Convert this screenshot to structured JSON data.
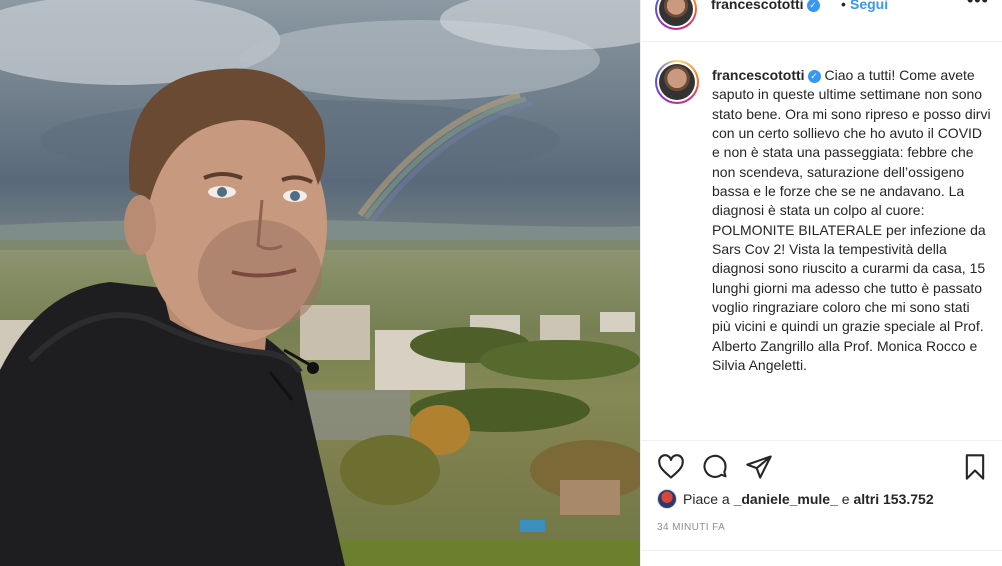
{
  "post": {
    "username": "francescototti",
    "verified": true,
    "follow_label": "Segui",
    "dot": "•",
    "more_label": "•••"
  },
  "caption": {
    "username": "francescototti",
    "text": "Ciao a tutti! Come avete saputo in queste ultime settimane non sono stato bene. Ora mi sono ripreso e posso dirvi con un certo sollievo che ho avuto il COVID e non è stata una passeggiata: febbre che non scendeva, saturazione dell’ossigeno bassa e le forze che se ne andavano. La diagnosi è stata un colpo al cuore: POLMONITE BILATERALE per infezione da Sars Cov 2! Vista la tempestività della diagnosi sono riuscito a curarmi da casa, 15 lunghi giorni ma adesso che tutto è passato voglio ringraziare coloro che mi sono stati più vicini e quindi un grazie speciale al Prof. Alberto Zangrillo alla Prof. Monica Rocco e Silvia Angeletti."
  },
  "actions": {
    "icons": [
      "heart-icon",
      "comment-icon",
      "share-icon",
      "bookmark-icon"
    ]
  },
  "likes": {
    "prefix": "Piace a ",
    "user": "_daniele_mule_",
    "middle": " e ",
    "others": "altri 153.752"
  },
  "timestamp": "34 MINUTI FA",
  "colors": {
    "accent": "#3897f0",
    "text": "#262626",
    "muted": "#8e8e8e",
    "border": "#efefef"
  }
}
